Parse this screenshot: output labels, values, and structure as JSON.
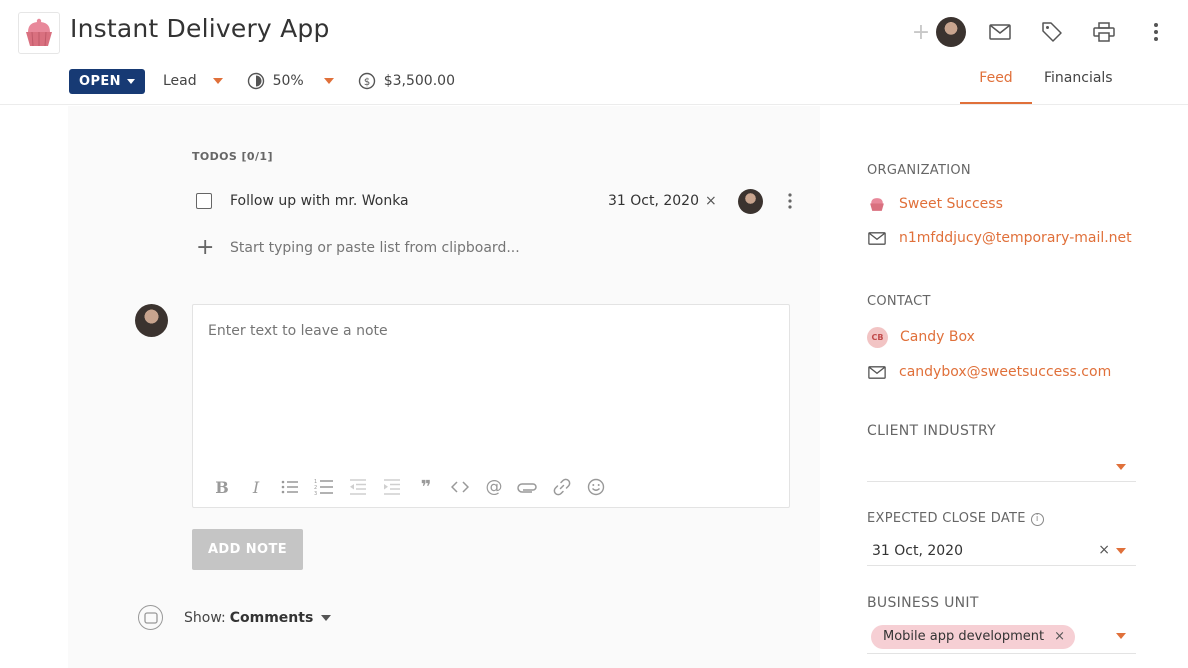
{
  "header": {
    "title": "Instant Delivery App",
    "status": "OPEN",
    "stage": "Lead",
    "probability": "50%",
    "amount": "$3,500.00",
    "actions": {
      "add_icon": "plus-icon",
      "avatar": "user-avatar",
      "email_icon": "envelope-icon",
      "tag_icon": "tag-icon",
      "print_icon": "printer-icon",
      "more_icon": "kebab-menu-icon"
    }
  },
  "tabs": [
    {
      "label": "Feed",
      "active": true
    },
    {
      "label": "Financials",
      "active": false
    }
  ],
  "todos": {
    "title": "TODOS [0/1]",
    "items": [
      {
        "text": "Follow up with mr. Wonka",
        "date": "31 Oct, 2020",
        "clear": "×",
        "checked": false
      }
    ],
    "add_placeholder": "Start typing or paste list from clipboard..."
  },
  "note": {
    "placeholder": "Enter text to leave a note",
    "button_label": "ADD NOTE",
    "toolbar_icons": [
      "bold-icon",
      "italic-icon",
      "bullet-list-icon",
      "numbered-list-icon",
      "outdent-icon",
      "indent-icon",
      "quote-icon",
      "code-icon",
      "mention-icon",
      "attachment-icon",
      "link-icon",
      "emoji-icon"
    ]
  },
  "filter": {
    "label": "Show:",
    "value": "Comments"
  },
  "panel": {
    "organization": {
      "heading": "ORGANIZATION",
      "name": "Sweet Success",
      "email": "n1mfddjucy@temporary-mail.net"
    },
    "contact": {
      "heading": "CONTACT",
      "initials": "CB",
      "name": "Candy Box",
      "email": "candybox@sweetsuccess.com"
    },
    "client_industry": {
      "heading": "CLIENT INDUSTRY",
      "value": ""
    },
    "expected_close_date": {
      "heading": "EXPECTED CLOSE DATE",
      "info": "i",
      "value": "31 Oct, 2020",
      "clear": "×"
    },
    "business_unit": {
      "heading": "BUSINESS UNIT",
      "chip": "Mobile app development",
      "chip_clear": "×"
    }
  },
  "colors": {
    "accent": "#e0703a",
    "status_bg": "#173a74",
    "chip_bg": "#f6cfd4",
    "button_disabled": "#c5c5c5"
  }
}
